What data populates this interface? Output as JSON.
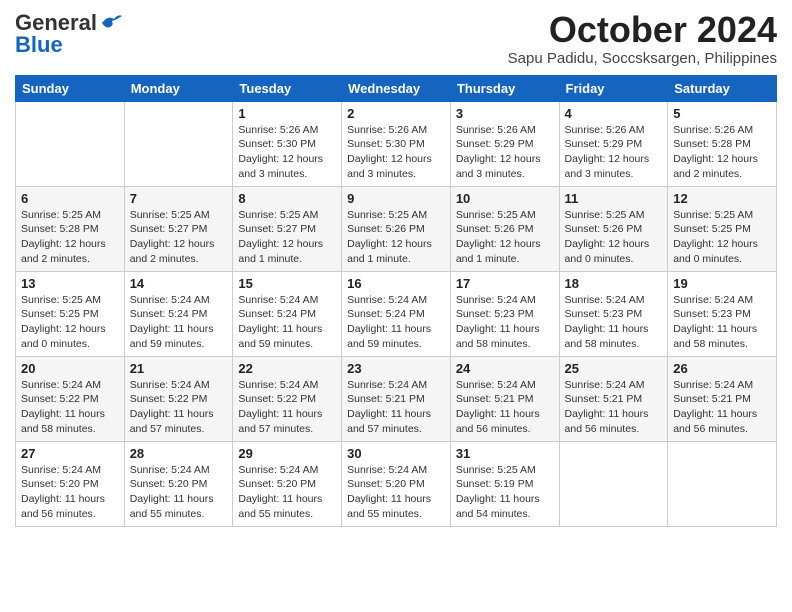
{
  "header": {
    "logo_general": "General",
    "logo_blue": "Blue",
    "month_title": "October 2024",
    "location": "Sapu Padidu, Soccsksargen, Philippines"
  },
  "weekdays": [
    "Sunday",
    "Monday",
    "Tuesday",
    "Wednesday",
    "Thursday",
    "Friday",
    "Saturday"
  ],
  "weeks": [
    [
      {
        "day": "",
        "info": ""
      },
      {
        "day": "",
        "info": ""
      },
      {
        "day": "1",
        "info": "Sunrise: 5:26 AM\nSunset: 5:30 PM\nDaylight: 12 hours and 3 minutes."
      },
      {
        "day": "2",
        "info": "Sunrise: 5:26 AM\nSunset: 5:30 PM\nDaylight: 12 hours and 3 minutes."
      },
      {
        "day": "3",
        "info": "Sunrise: 5:26 AM\nSunset: 5:29 PM\nDaylight: 12 hours and 3 minutes."
      },
      {
        "day": "4",
        "info": "Sunrise: 5:26 AM\nSunset: 5:29 PM\nDaylight: 12 hours and 3 minutes."
      },
      {
        "day": "5",
        "info": "Sunrise: 5:26 AM\nSunset: 5:28 PM\nDaylight: 12 hours and 2 minutes."
      }
    ],
    [
      {
        "day": "6",
        "info": "Sunrise: 5:25 AM\nSunset: 5:28 PM\nDaylight: 12 hours and 2 minutes."
      },
      {
        "day": "7",
        "info": "Sunrise: 5:25 AM\nSunset: 5:27 PM\nDaylight: 12 hours and 2 minutes."
      },
      {
        "day": "8",
        "info": "Sunrise: 5:25 AM\nSunset: 5:27 PM\nDaylight: 12 hours and 1 minute."
      },
      {
        "day": "9",
        "info": "Sunrise: 5:25 AM\nSunset: 5:26 PM\nDaylight: 12 hours and 1 minute."
      },
      {
        "day": "10",
        "info": "Sunrise: 5:25 AM\nSunset: 5:26 PM\nDaylight: 12 hours and 1 minute."
      },
      {
        "day": "11",
        "info": "Sunrise: 5:25 AM\nSunset: 5:26 PM\nDaylight: 12 hours and 0 minutes."
      },
      {
        "day": "12",
        "info": "Sunrise: 5:25 AM\nSunset: 5:25 PM\nDaylight: 12 hours and 0 minutes."
      }
    ],
    [
      {
        "day": "13",
        "info": "Sunrise: 5:25 AM\nSunset: 5:25 PM\nDaylight: 12 hours and 0 minutes."
      },
      {
        "day": "14",
        "info": "Sunrise: 5:24 AM\nSunset: 5:24 PM\nDaylight: 11 hours and 59 minutes."
      },
      {
        "day": "15",
        "info": "Sunrise: 5:24 AM\nSunset: 5:24 PM\nDaylight: 11 hours and 59 minutes."
      },
      {
        "day": "16",
        "info": "Sunrise: 5:24 AM\nSunset: 5:24 PM\nDaylight: 11 hours and 59 minutes."
      },
      {
        "day": "17",
        "info": "Sunrise: 5:24 AM\nSunset: 5:23 PM\nDaylight: 11 hours and 58 minutes."
      },
      {
        "day": "18",
        "info": "Sunrise: 5:24 AM\nSunset: 5:23 PM\nDaylight: 11 hours and 58 minutes."
      },
      {
        "day": "19",
        "info": "Sunrise: 5:24 AM\nSunset: 5:23 PM\nDaylight: 11 hours and 58 minutes."
      }
    ],
    [
      {
        "day": "20",
        "info": "Sunrise: 5:24 AM\nSunset: 5:22 PM\nDaylight: 11 hours and 58 minutes."
      },
      {
        "day": "21",
        "info": "Sunrise: 5:24 AM\nSunset: 5:22 PM\nDaylight: 11 hours and 57 minutes."
      },
      {
        "day": "22",
        "info": "Sunrise: 5:24 AM\nSunset: 5:22 PM\nDaylight: 11 hours and 57 minutes."
      },
      {
        "day": "23",
        "info": "Sunrise: 5:24 AM\nSunset: 5:21 PM\nDaylight: 11 hours and 57 minutes."
      },
      {
        "day": "24",
        "info": "Sunrise: 5:24 AM\nSunset: 5:21 PM\nDaylight: 11 hours and 56 minutes."
      },
      {
        "day": "25",
        "info": "Sunrise: 5:24 AM\nSunset: 5:21 PM\nDaylight: 11 hours and 56 minutes."
      },
      {
        "day": "26",
        "info": "Sunrise: 5:24 AM\nSunset: 5:21 PM\nDaylight: 11 hours and 56 minutes."
      }
    ],
    [
      {
        "day": "27",
        "info": "Sunrise: 5:24 AM\nSunset: 5:20 PM\nDaylight: 11 hours and 56 minutes."
      },
      {
        "day": "28",
        "info": "Sunrise: 5:24 AM\nSunset: 5:20 PM\nDaylight: 11 hours and 55 minutes."
      },
      {
        "day": "29",
        "info": "Sunrise: 5:24 AM\nSunset: 5:20 PM\nDaylight: 11 hours and 55 minutes."
      },
      {
        "day": "30",
        "info": "Sunrise: 5:24 AM\nSunset: 5:20 PM\nDaylight: 11 hours and 55 minutes."
      },
      {
        "day": "31",
        "info": "Sunrise: 5:25 AM\nSunset: 5:19 PM\nDaylight: 11 hours and 54 minutes."
      },
      {
        "day": "",
        "info": ""
      },
      {
        "day": "",
        "info": ""
      }
    ]
  ]
}
